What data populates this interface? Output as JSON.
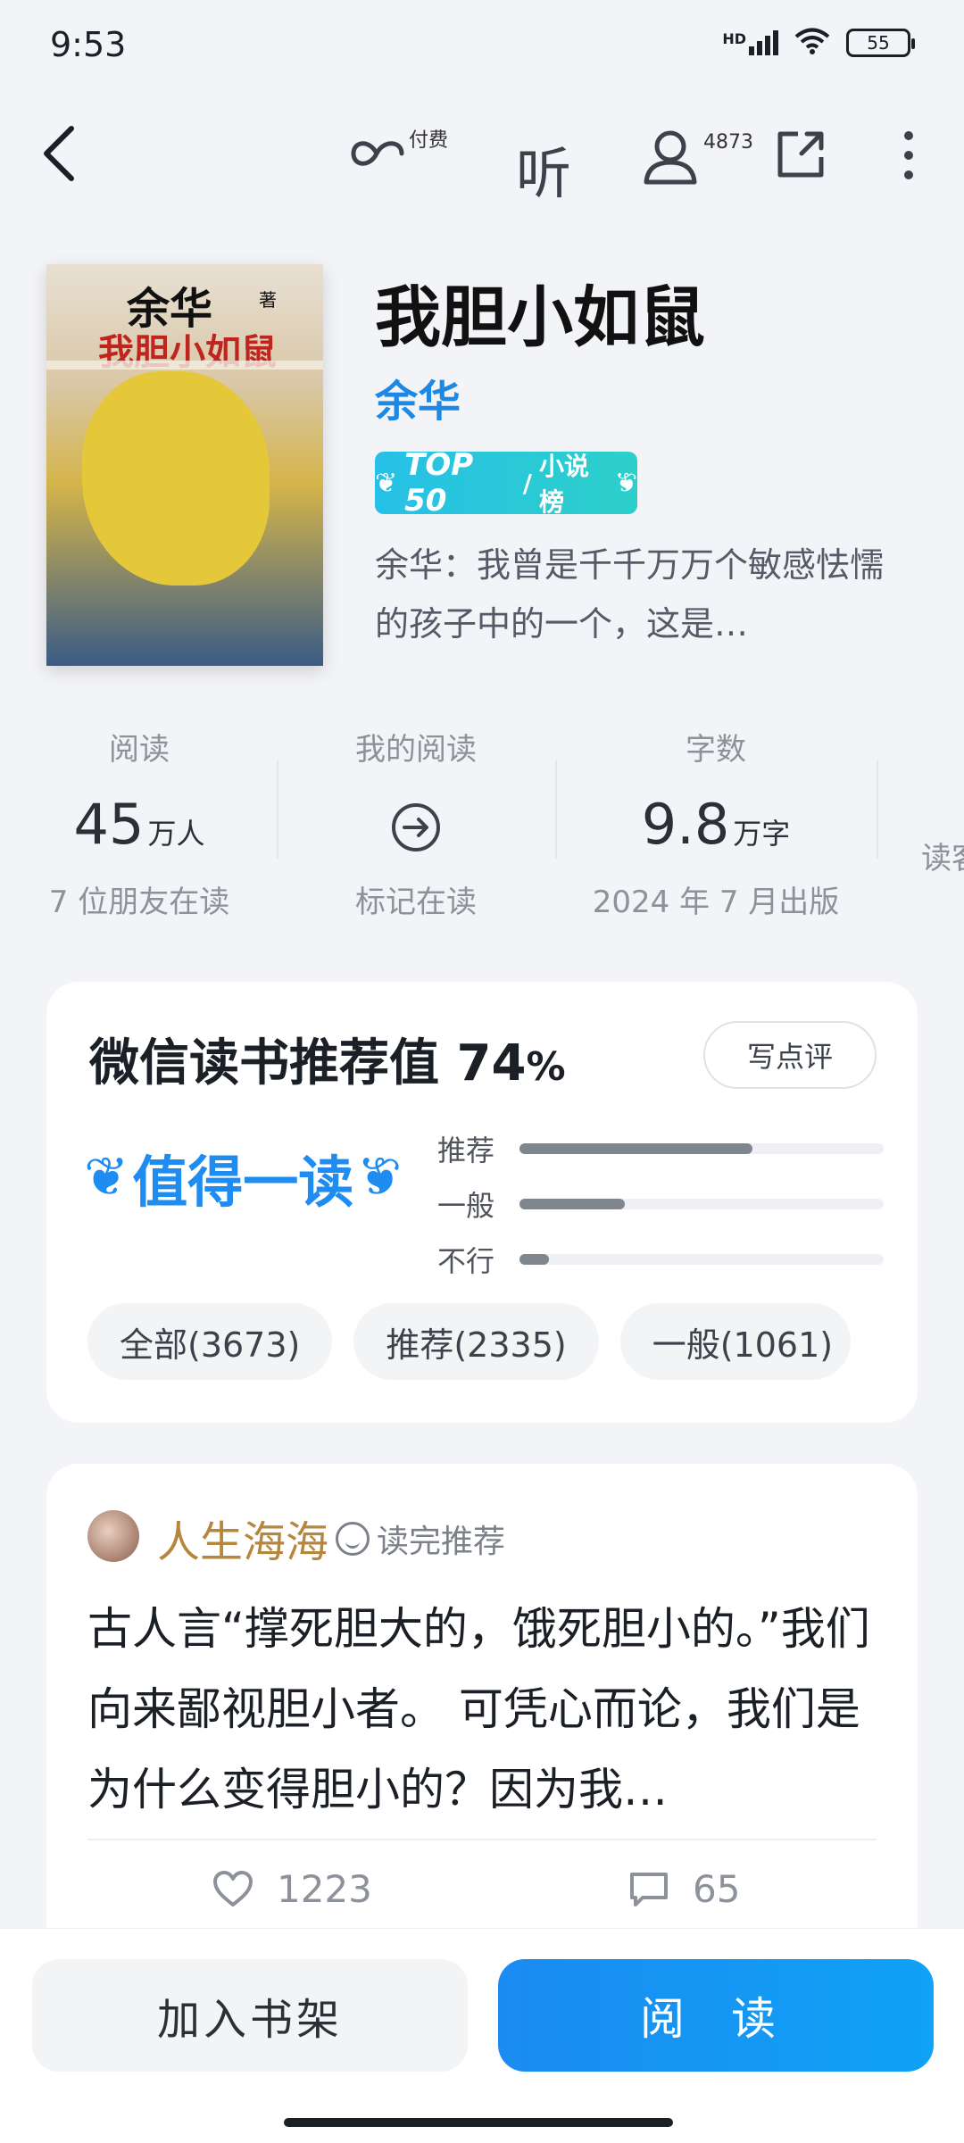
{
  "status_bar": {
    "time": "9:53",
    "battery": "55",
    "network": "HD"
  },
  "topbar": {
    "pay_label": "付费",
    "listen_label": "听",
    "followers": "4873"
  },
  "book": {
    "title": "我胆小如鼠",
    "author": "余华",
    "badge_top": "TOP 50",
    "badge_list": "小说榜",
    "description": "余华：我曾是千千万万个敏感怯懦的孩子中的一个，这是…",
    "cover": {
      "author": "余华",
      "zhu": "著",
      "title": "我胆小如鼠"
    }
  },
  "stats": [
    {
      "label": "阅读",
      "value": "45",
      "unit": "万人",
      "sub": "7 位朋友在读"
    },
    {
      "label": "我的阅读",
      "value": "",
      "unit": "",
      "sub": "标记在读"
    },
    {
      "label": "字数",
      "value": "9.8",
      "unit": "万字",
      "sub": "2024 年 7 月出版"
    },
    {
      "label": "",
      "value": "",
      "unit": "",
      "sub": "读客"
    }
  ],
  "recommend": {
    "title_prefix": "微信读书推荐值 ",
    "score": "74",
    "percent": "%",
    "write_review": "写点评",
    "verdict": "值得一读",
    "bars": [
      {
        "label": "推荐",
        "fraction": 0.64
      },
      {
        "label": "一般",
        "fraction": 0.29
      },
      {
        "label": "不行",
        "fraction": 0.08
      }
    ],
    "filters": [
      "全部(3673)",
      "推荐(2335)",
      "一般(1061)"
    ]
  },
  "review": {
    "user": "人生海海",
    "tag": "读完推荐",
    "body": "古人言“撑死胆大的，饿死胆小的。”我们向来鄙视胆小者。 可凭心而论，我们是为什么变得胆小的？因为我…",
    "likes": "1223",
    "comments": "65"
  },
  "bottom": {
    "add_shelf": "加入书架",
    "read": "阅 读"
  }
}
